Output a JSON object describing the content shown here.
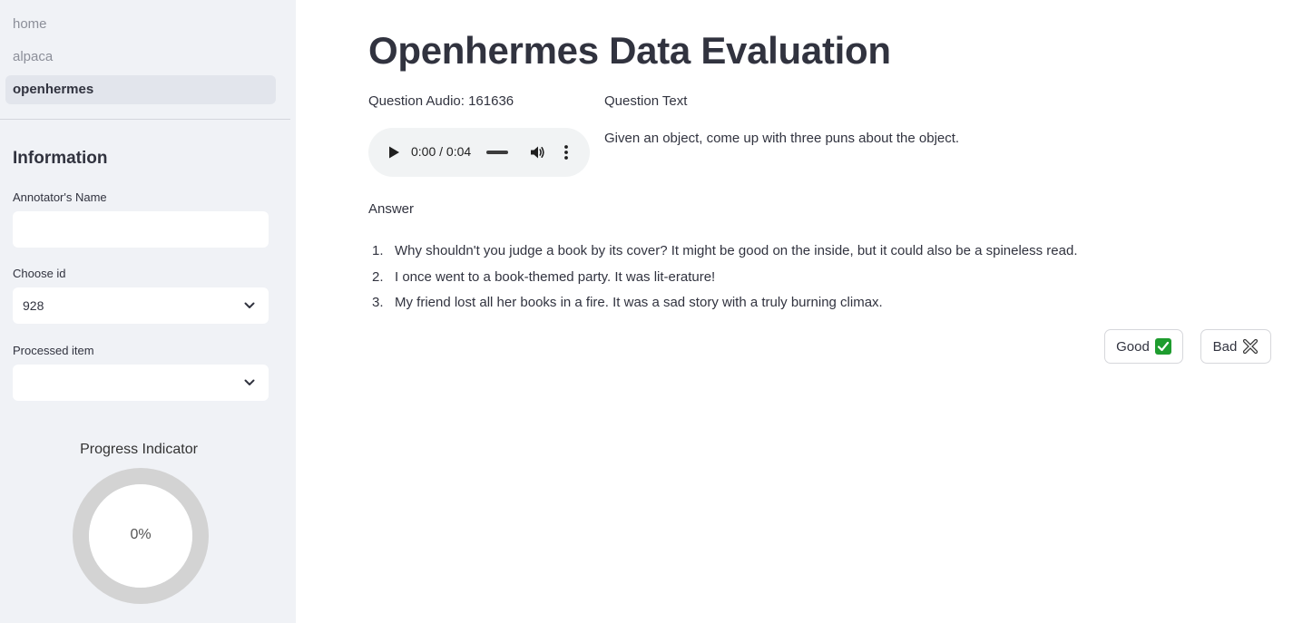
{
  "sidebar": {
    "nav": [
      {
        "label": "home"
      },
      {
        "label": "alpaca"
      },
      {
        "label": "openhermes"
      }
    ],
    "active_nav": "openhermes",
    "heading": "Information",
    "annotator_label": "Annotator's Name",
    "annotator_value": "",
    "choose_id_label": "Choose id",
    "choose_id_value": "928",
    "processed_label": "Processed item",
    "processed_value": "",
    "progress_title": "Progress Indicator",
    "progress_text": "0%",
    "progress_fraction": 0
  },
  "main": {
    "title": "Openhermes Data Evaluation",
    "question_audio_label": "Question Audio: 161636",
    "audio_time": "0:00 / 0:04",
    "question_text_label": "Question Text",
    "question_text": "Given an object, come up with three puns about the object.",
    "answer_label": "Answer",
    "answers": [
      {
        "num": "1.",
        "text": "Why shouldn't you judge a book by its cover? It might be good on the inside, but it could also be a spineless read."
      },
      {
        "num": "2.",
        "text": "I once went to a book-themed party. It was lit-erature!"
      },
      {
        "num": "3.",
        "text": "My friend lost all her books in a fire. It was a sad story with a truly burning climax."
      }
    ],
    "good_button": "Good",
    "bad_button": "Bad"
  },
  "colors": {
    "sidebar_bg": "#f0f2f6",
    "text": "#31333f",
    "good_check": "#1e9c2e"
  },
  "icons": [
    "play-icon",
    "volume-icon",
    "more-vertical-icon",
    "chevron-down-icon",
    "check-mark-icon",
    "cross-mark-icon"
  ]
}
